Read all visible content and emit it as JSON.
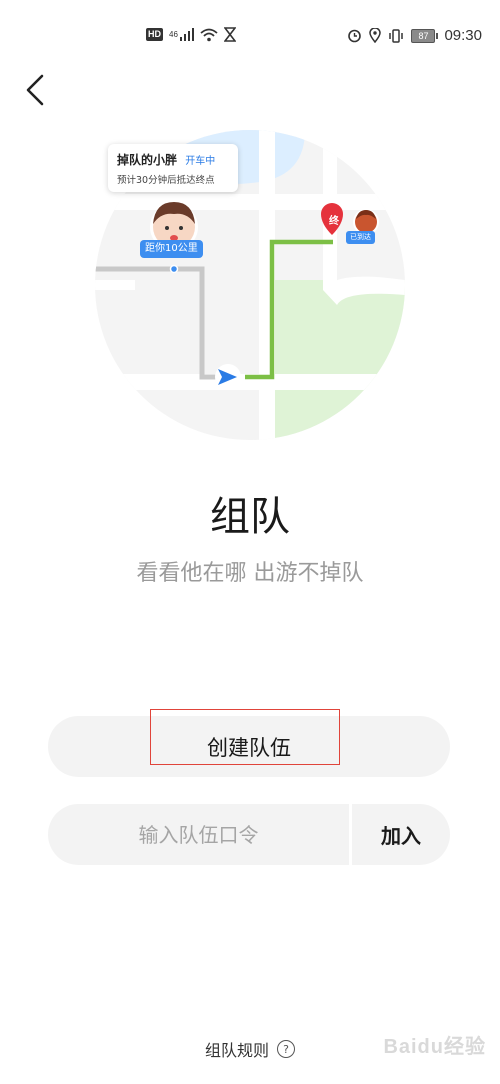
{
  "status_bar": {
    "hd_badge": "HD",
    "network": "46",
    "battery": "87",
    "time": "09:30",
    "icons": [
      "signal-icon",
      "wifi-icon",
      "hourglass-icon",
      "alarm-icon",
      "location-icon",
      "vibrate-icon",
      "battery-icon"
    ]
  },
  "map": {
    "card_name": "掉队的小胖",
    "card_status": "开车中",
    "card_eta": "预计30分钟后抵达终点",
    "distance_label": "距你10公里",
    "end_label": "终",
    "arrived_label": "已到达",
    "colors": {
      "route": "#7cbf45",
      "water": "#dceeff",
      "park": "#dff3d6",
      "blue": "#3d8ef0",
      "end_pin": "#e5323c"
    }
  },
  "title": "组队",
  "subtitle": "看看他在哪  出游不掉队",
  "create_button_label": "创建队伍",
  "join": {
    "placeholder": "输入队伍口令",
    "button_label": "加入"
  },
  "rules_link_label": "组队规则",
  "watermark": "Baidu经验"
}
